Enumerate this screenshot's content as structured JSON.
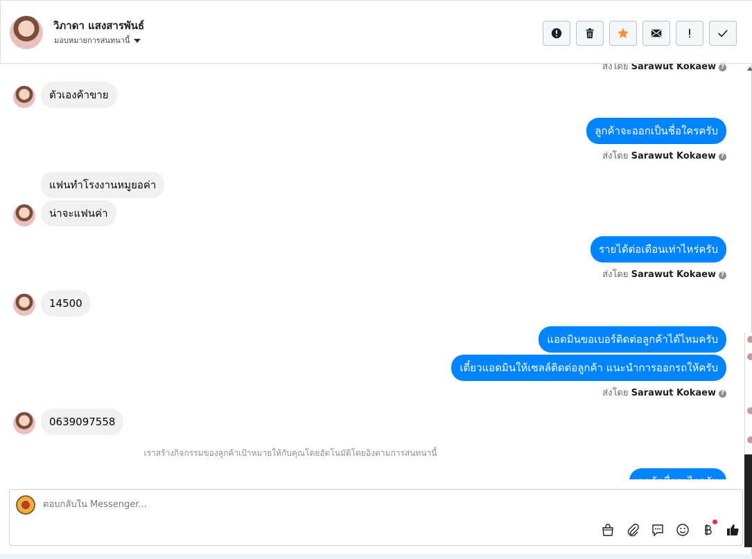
{
  "header": {
    "contact_name": "วิภาดา แสงสารพันธ์",
    "subtitle": "มอบหมายการสนทนานี้"
  },
  "actions": [
    {
      "name": "spam-button",
      "icon": "alert-circle-icon"
    },
    {
      "name": "delete-button",
      "icon": "trash-icon"
    },
    {
      "name": "star-button",
      "icon": "star-icon",
      "color": "#f7923b"
    },
    {
      "name": "mark-unread-button",
      "icon": "envelope-icon"
    },
    {
      "name": "follow-up-button",
      "icon": "exclamation-icon"
    },
    {
      "name": "done-button",
      "icon": "check-icon"
    }
  ],
  "conversation": {
    "sent_by_prefix": "ส่งโดย",
    "sender": "Sarawut Kokaew",
    "messages": {
      "m1": "ตัวเองค้าขาย",
      "m2": "ลูกค้าจะออกเป็นชื่อใครครับ",
      "m3": "แฟนทำโรงงานหมูยอค่า",
      "m4": "น่าจะแฟนค่า",
      "m5": "รายได้ต่อเดือนเท่าไหร่ครับ",
      "m6": "14500",
      "m7": "แอดมินขอเบอร์ติดต่อลูกค้าได้ไหมครับ",
      "m8": "เดี๋ยวแอดมินให้เซลล์ติดต่อลูกค้า แนะนำการออกรถให้ครับ",
      "m9": "0639097558",
      "m10": "ลูกค้าชื่ออะไรครับ"
    },
    "system_note": "เราสร้างกิจกรรมของลูกค้าเป้าหมายให้กับคุณโดยอัตโนมัติโดยอิงตามการสนทนานี้"
  },
  "composer": {
    "placeholder": "ตอบกลับใน Messenger..."
  },
  "colors": {
    "outgoing_bubble": "#0084ff",
    "incoming_bubble": "#f0f0f0",
    "badge_dot": "#f02849"
  }
}
